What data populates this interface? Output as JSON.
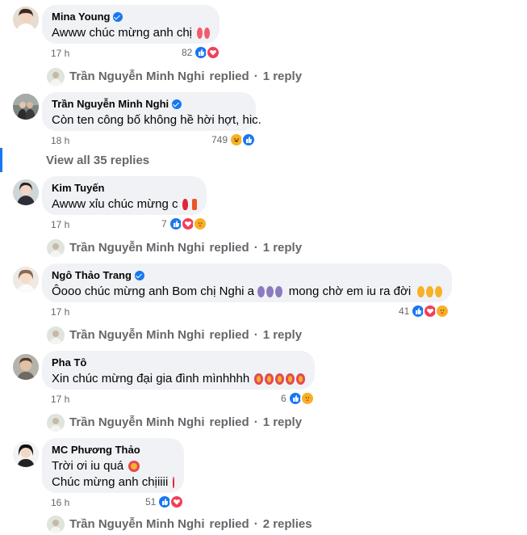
{
  "comments": [
    {
      "author": "Mina Young",
      "verified": true,
      "text": "Awww chúc mừng anh chị",
      "emojis": [
        "love-hearts",
        "love-hearts"
      ],
      "time": "17 h",
      "reaction_count": "82",
      "reactions": [
        "like",
        "love"
      ],
      "reply_summary": {
        "author": "Trần Nguyễn Minh Nghi",
        "action": "replied",
        "sep": "·",
        "count": "1 reply"
      }
    },
    {
      "author": "Trần Nguyễn Minh Nghi",
      "verified": true,
      "text": "Còn ten công bố không hề hời hợt, hic.",
      "emojis": [],
      "time": "18 h",
      "reaction_count": "749",
      "reactions": [
        "haha",
        "like"
      ]
    },
    {
      "author": "Kim Tuyến",
      "verified": false,
      "text": "Awww xỉu chúc mừng c",
      "emojis": [
        "balloon",
        "gift"
      ],
      "time": "17 h",
      "reaction_count": "7",
      "reactions": [
        "like",
        "love",
        "care"
      ],
      "reply_summary": {
        "author": "Trần Nguyễn Minh Nghi",
        "action": "replied",
        "sep": "·",
        "count": "1 reply"
      }
    },
    {
      "author": "Ngô Thảo Trang",
      "verified": true,
      "text": "Ôooo chúc mừng anh Bom chị Nghi a",
      "text_after": "mong chờ em iu ra đời",
      "emojis": [
        "pray",
        "pray",
        "pray"
      ],
      "emojis_after": [
        "smile",
        "smile",
        "smile"
      ],
      "time": "17 h",
      "reaction_count": "41",
      "reactions": [
        "like",
        "love",
        "care"
      ],
      "reply_summary": {
        "author": "Trần Nguyễn Minh Nghi",
        "action": "replied",
        "sep": "·",
        "count": "1 reply"
      }
    },
    {
      "author": "Pha Tô",
      "verified": false,
      "text": "Xin chúc mừng đại gia đình mìnhhhh",
      "emojis": [
        "heart-face",
        "heart-face",
        "heart-face",
        "heart-face",
        "heart-face"
      ],
      "time": "17 h",
      "reaction_count": "6",
      "reactions": [
        "like",
        "care"
      ],
      "reply_summary": {
        "author": "Trần Nguyễn Minh Nghi",
        "action": "replied",
        "sep": "·",
        "count": "1 reply"
      }
    },
    {
      "author": "MC Phương Thảo",
      "verified": false,
      "text_line1": "Trời ơi iu quá",
      "text_line2": "Chúc mừng anh chịiiii",
      "emojis": [
        "heart-face"
      ],
      "emojis_line2": [
        "red-heart"
      ],
      "time": "16 h",
      "reaction_count": "51",
      "reactions": [
        "like",
        "love"
      ],
      "reply_summary": {
        "author": "Trần Nguyễn Minh Nghi",
        "action": "replied",
        "sep": "·",
        "count": "2 replies"
      }
    }
  ],
  "view_all_replies": "View all 35 replies",
  "colors": {
    "bubble": "#f0f2f5",
    "secondary_text": "#65676b",
    "like_blue": "#1877f2",
    "love_red": "#f33e58",
    "haha_yellow": "#f7b125"
  }
}
